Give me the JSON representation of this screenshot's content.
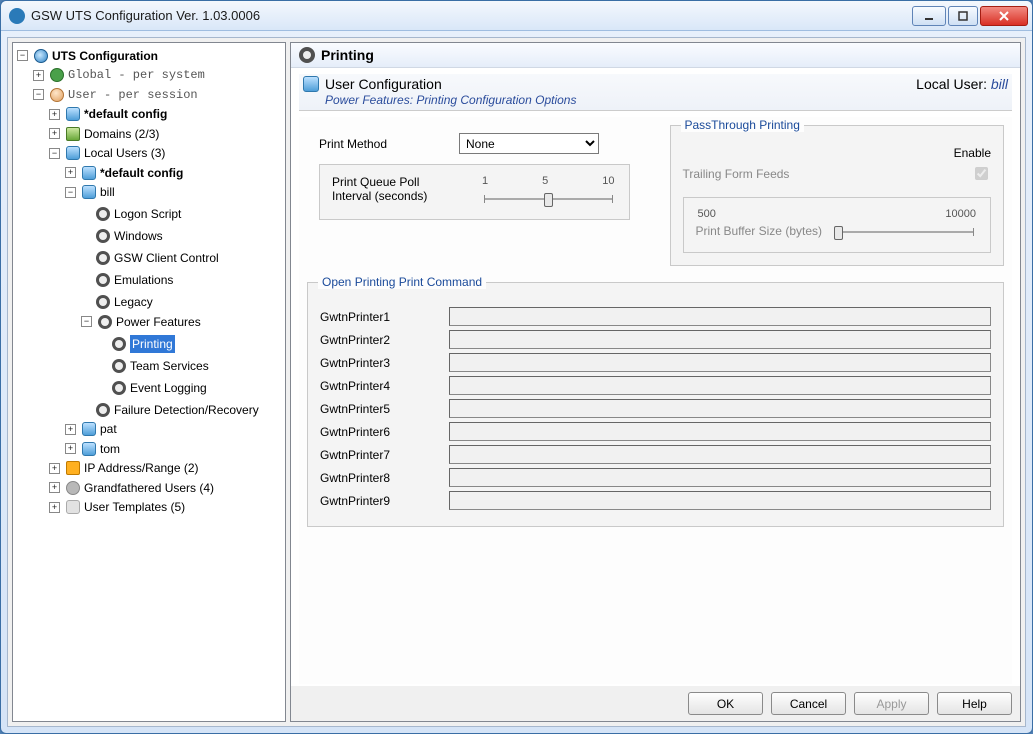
{
  "window": {
    "title": "GSW UTS Configuration    Ver. 1.03.0006"
  },
  "tree": {
    "root": "UTS Configuration",
    "global": "Global - per system",
    "user_session": "User   - per session",
    "default_config": "*default config",
    "domains": "Domains (2/3)",
    "local_users": "Local Users (3)",
    "default_config2": "*default config",
    "bill": "bill",
    "bill_items": {
      "logon": "Logon Script",
      "windows": "Windows",
      "client_control": "GSW Client Control",
      "emulations": "Emulations",
      "legacy": "Legacy",
      "power_features": "Power Features",
      "printing": "Printing",
      "team_services": "Team Services",
      "event_logging": "Event Logging",
      "failure": "Failure Detection/Recovery"
    },
    "pat": "pat",
    "tom": "tom",
    "ip_range": "IP Address/Range (2)",
    "grandfathered": "Grandfathered Users (4)",
    "templates": "User Templates (5)"
  },
  "right": {
    "pane_title": "Printing",
    "section_title": "User Configuration",
    "local_user_label": "Local User:",
    "local_user_name": "bill",
    "subtitle": "Power Features: Printing Configuration Options",
    "print_method_label": "Print Method",
    "print_method_value": "None",
    "poll_interval_label": "Print Queue Poll Interval (seconds)",
    "poll_ticks": [
      "1",
      "5",
      "10"
    ],
    "passthrough_title": "PassThrough Printing",
    "passthrough_enable_label": "Enable",
    "trailing_label": "Trailing Form Feeds",
    "buffer_label": "Print Buffer Size (bytes)",
    "buffer_ticks": [
      "500",
      "10000"
    ],
    "open_printing_title": "Open Printing Print Command",
    "printers": [
      "GwtnPrinter1",
      "GwtnPrinter2",
      "GwtnPrinter3",
      "GwtnPrinter4",
      "GwtnPrinter5",
      "GwtnPrinter6",
      "GwtnPrinter7",
      "GwtnPrinter8",
      "GwtnPrinter9"
    ]
  },
  "buttons": {
    "ok": "OK",
    "cancel": "Cancel",
    "apply": "Apply",
    "help": "Help"
  }
}
